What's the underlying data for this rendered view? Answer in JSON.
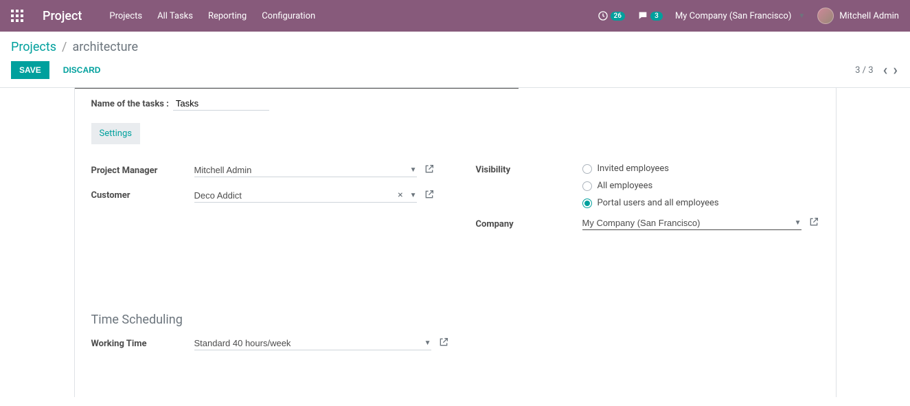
{
  "header": {
    "brand": "Project",
    "nav": [
      "Projects",
      "All Tasks",
      "Reporting",
      "Configuration"
    ],
    "activity_count": "26",
    "discuss_count": "3",
    "company": "My Company (San Francisco)",
    "user": "Mitchell Admin"
  },
  "breadcrumb": {
    "root": "Projects",
    "current": "architecture"
  },
  "actions": {
    "save": "Save",
    "discard": "Discard",
    "pager": "3 / 3"
  },
  "form": {
    "tasks_label": "Name of the tasks :",
    "tasks_value": "Tasks",
    "tab_settings": "Settings",
    "labels": {
      "project_manager": "Project Manager",
      "customer": "Customer",
      "visibility": "Visibility",
      "company": "Company",
      "working_time": "Working Time"
    },
    "values": {
      "project_manager": "Mitchell Admin",
      "customer": "Deco Addict",
      "company": "My Company (San Francisco)",
      "working_time": "Standard 40 hours/week"
    },
    "visibility_options": [
      {
        "label": "Invited employees",
        "checked": false
      },
      {
        "label": "All employees",
        "checked": false
      },
      {
        "label": "Portal users and all employees",
        "checked": true
      }
    ],
    "section_time": "Time Scheduling"
  }
}
